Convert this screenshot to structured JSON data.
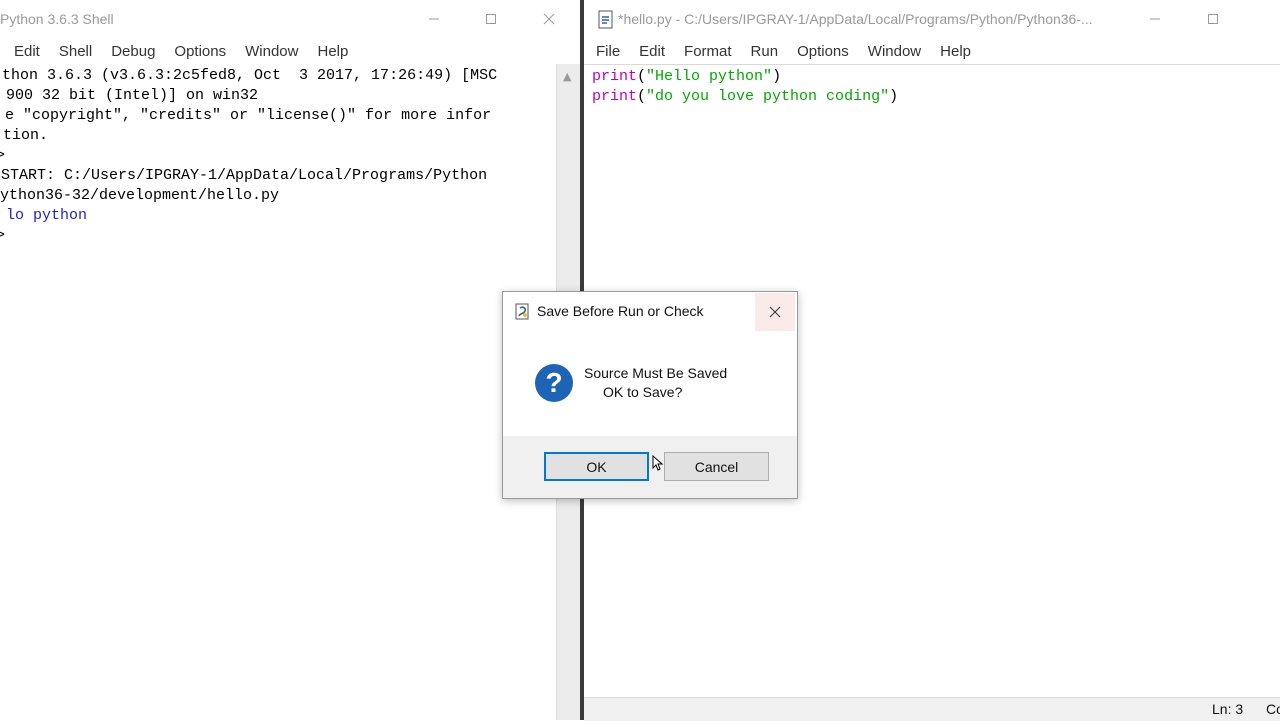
{
  "shell": {
    "title": "Python 3.6.3 Shell",
    "menu": [
      "Edit",
      "Shell",
      "Debug",
      "Options",
      "Window",
      "Help"
    ],
    "lines": [
      "thon 3.6.3 (v3.6.3:2c5fed8, Oct  3 2017, 17:26:49) [MSC",
      "900 32 bit (Intel)] on win32",
      "e \"copyright\", \"credits\" or \"license()\" for more infor",
      "tion.",
      ">",
      "START: C:/Users/IPGRAY-1/AppData/Local/Programs/Python",
      "ython36-32/development/hello.py",
      "lo python",
      ">"
    ]
  },
  "editor": {
    "title": "*hello.py - C:/Users/IPGRAY-1/AppData/Local/Programs/Python/Python36-...",
    "menu": [
      "File",
      "Edit",
      "Format",
      "Run",
      "Options",
      "Window",
      "Help"
    ],
    "code": [
      {
        "kw": "print",
        "open": "(",
        "str": "\"Hello python\"",
        "close": ")"
      },
      {
        "kw": "print",
        "open": "(",
        "str": "\"do you love python coding\"",
        "close": ")"
      }
    ],
    "status_ln": "Ln: 3",
    "status_col": "Col:"
  },
  "dialog": {
    "title": "Save Before Run or Check",
    "message_line1": "Source Must Be Saved",
    "message_line2": "OK to Save?",
    "ok_label": "OK",
    "cancel_label": "Cancel",
    "icon": "question-icon"
  },
  "colors": {
    "keyword": "#c000c0",
    "string": "#00aa00",
    "shell_output": "#1f1fcf",
    "dialog_icon": "#1e64b4",
    "ok_focus": "#0078d7"
  }
}
